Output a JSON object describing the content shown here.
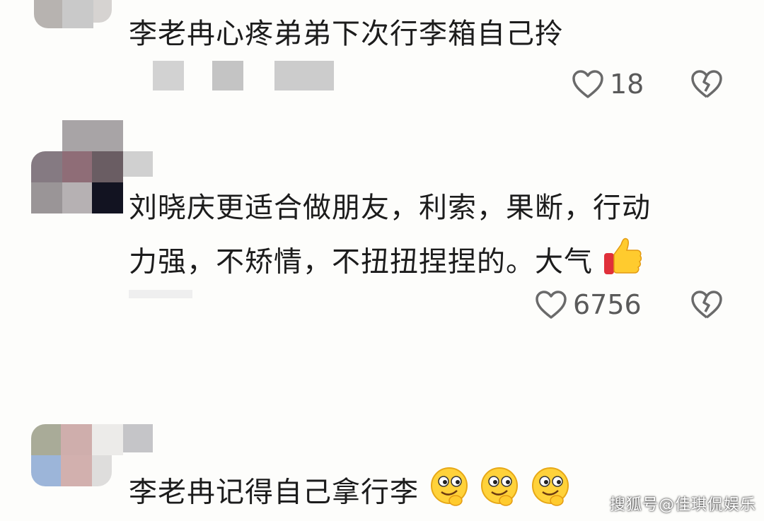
{
  "comments": [
    {
      "text": "李老冉心疼弟弟下次行李箱自己拎",
      "likes": "18"
    },
    {
      "text_line1": "刘晓庆更适合做朋友，利索，果断，行动",
      "text_line2": "力强，不矫情，不扭扭捏捏的。大气",
      "likes": "6756",
      "emoji": "thumbs-up"
    },
    {
      "text": "李老冉记得自己拿行李",
      "emoji": "smirk-face"
    }
  ],
  "watermark": "搜狐号@佳琪侃娱乐",
  "colors": {
    "background": "#fdfdfb",
    "text": "#1c1c1c",
    "count": "#5a5a5a",
    "icon_stroke": "#6a6a6a"
  },
  "icons": [
    "heart-outline-icon",
    "broken-heart-icon",
    "thumbs-up-emoji",
    "smirk-face-emoji"
  ]
}
